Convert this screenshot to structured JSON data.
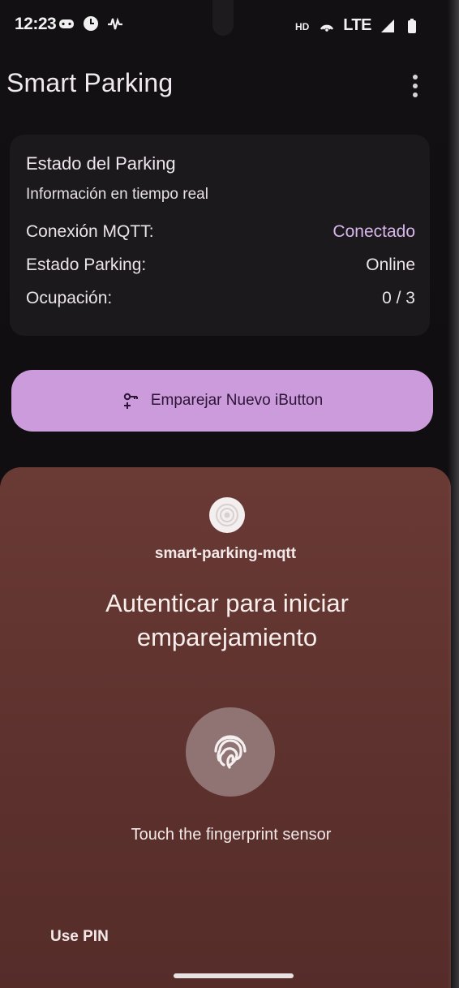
{
  "status_bar": {
    "time": "12:23",
    "network": "LTE",
    "left_icons": [
      "gamepad-icon",
      "clock-icon",
      "activity-icon"
    ],
    "right_icons": [
      "hd-voice-icon",
      "hotspot-icon",
      "signal-icon",
      "battery-icon"
    ]
  },
  "app_bar": {
    "title": "Smart Parking",
    "menu_icon": "more-vert-icon"
  },
  "status_card": {
    "title": "Estado del Parking",
    "subtitle": "Información en tiempo real",
    "rows": [
      {
        "label": "Conexión MQTT:",
        "value": "Conectado"
      },
      {
        "label": "Estado Parking:",
        "value": "Online"
      },
      {
        "label": "Ocupación:",
        "value": "0 / 3"
      }
    ]
  },
  "pair_button": {
    "label": "Emparejar Nuevo iButton",
    "icon": "key-plus-icon"
  },
  "biometric_sheet": {
    "app_name": "smart-parking-mqtt",
    "title": "Autenticar para iniciar emparejamiento",
    "hint": "Touch the fingerprint sensor",
    "use_pin": "Use PIN"
  },
  "colors": {
    "accent": "#cb9bdc",
    "accent_text": "#d9b6ec",
    "sheet": "#6a3a35",
    "card": "#1b191c"
  }
}
